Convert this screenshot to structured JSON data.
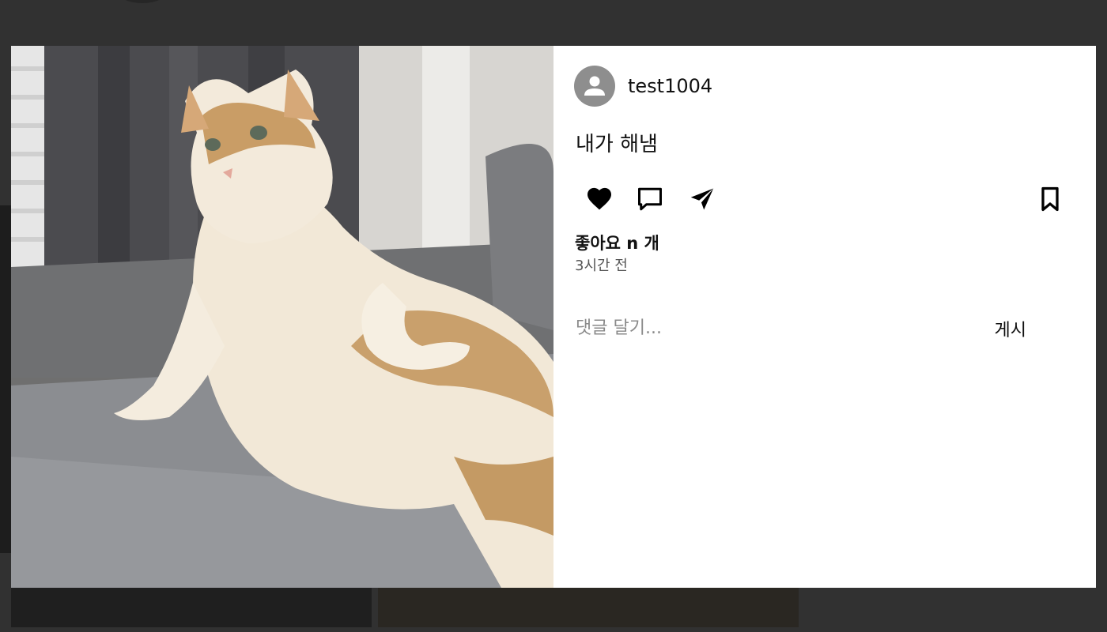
{
  "post": {
    "username": "test1004",
    "caption": "내가 해냄",
    "likes_label": "좋아요 n 개",
    "time_ago": "3시간 전",
    "image_subject": "cat sitting on a gray sofa"
  },
  "actions": {
    "like_icon": "heart-icon",
    "comment_icon": "comment-icon",
    "share_icon": "send-icon",
    "bookmark_icon": "bookmark-icon"
  },
  "comment": {
    "placeholder": "댓글 달기...",
    "post_label": "게시"
  },
  "colors": {
    "overlay": "#313131",
    "avatar_gray": "#8e8e8e",
    "panel_bg": "#ffffff",
    "text": "#111111"
  }
}
